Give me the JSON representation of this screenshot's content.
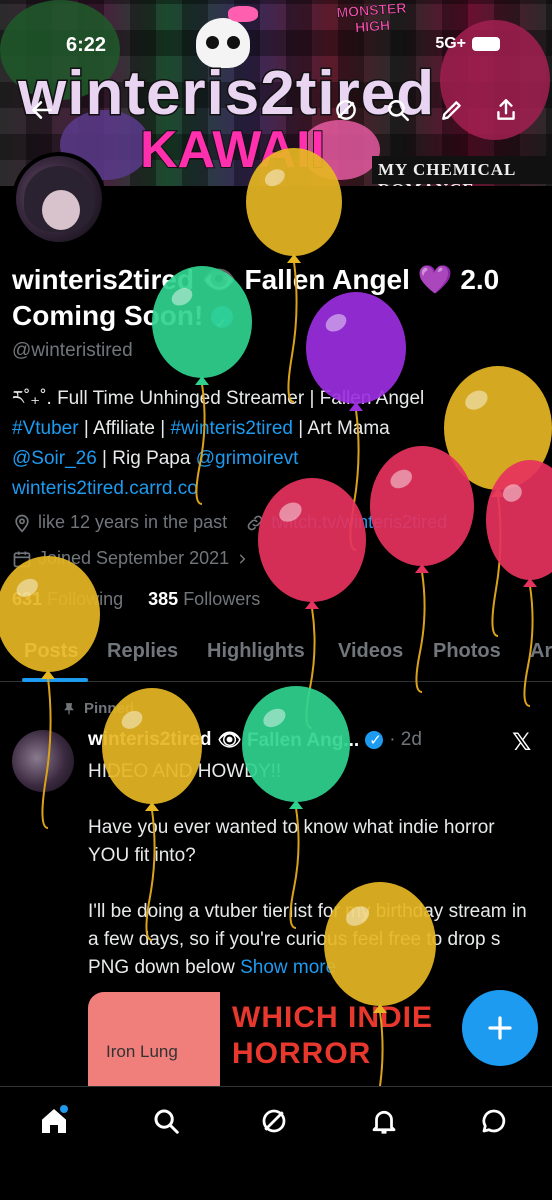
{
  "status_bar": {
    "time": "6:22",
    "network": "5G+"
  },
  "banner": {
    "username_art": "winteris2tired",
    "kawaii_art": "KAWAII",
    "monster_high_art": "MONSTER HIGH",
    "mcr_art": "MY CHEMICAL ROMANCE"
  },
  "profile": {
    "display_name": "winteris2tired 👁️ Fallen Angel 💜 2.0 Coming Soon!",
    "handle": "@winteristired",
    "bio": {
      "line1": "ར˚₊˚. Full Time Unhinged Streamer | Fallen Angel",
      "hashtag_vtuber": "#Vtuber",
      "sep1": " | Affiliate | ",
      "hashtag_name": "#winteris2tired",
      "sep2": " | Art Mama",
      "mention_soir": "@Soir_26",
      "sep3": " | Rig Papa ",
      "mention_grimoire": "@grimoirevt",
      "website": "winteris2tired.carrd.co"
    },
    "location": "like 12 years in the past",
    "link": "twitch.tv/winteris2tired",
    "joined": "Joined September 2021",
    "following_count": "631",
    "following_label": "Following",
    "followers_count": "385",
    "followers_label": "Followers"
  },
  "tabs": [
    "Posts",
    "Replies",
    "Highlights",
    "Videos",
    "Photos",
    "Ar"
  ],
  "post": {
    "pinned_label": "Pinned",
    "author_name": "winteris2tired",
    "author_name_suffix": "👁 Fallen Ang...",
    "time": "· 2d",
    "body": "HIDEO AND HOWDY!!\n\nHave you ever wanted to know what indie horror YOU fit into?\n\nI'll be doing a vtuber tierlist for my birthday stream in a few days, so if you're curious feel free to drop s PNG down below ",
    "show_more": "Show more",
    "media_left_label": "Iron Lung",
    "media_right_text_1": "WHICH INDIE",
    "media_right_text_2": "HORROR"
  },
  "colors": {
    "accent": "#1d9bf0",
    "balloon_yellow": "#e6b623",
    "balloon_green": "#2fd38f",
    "balloon_purple": "#9b2fe0",
    "balloon_pink": "#e6325e"
  },
  "icons": {
    "back": "back-arrow-icon",
    "grok": "grok-icon",
    "search": "search-icon",
    "edit": "pencil-icon",
    "share": "share-icon",
    "home": "home-icon",
    "explore": "search-icon",
    "notifications": "bell-icon",
    "messages": "chat-bubble-icon",
    "compose": "plus-icon"
  }
}
